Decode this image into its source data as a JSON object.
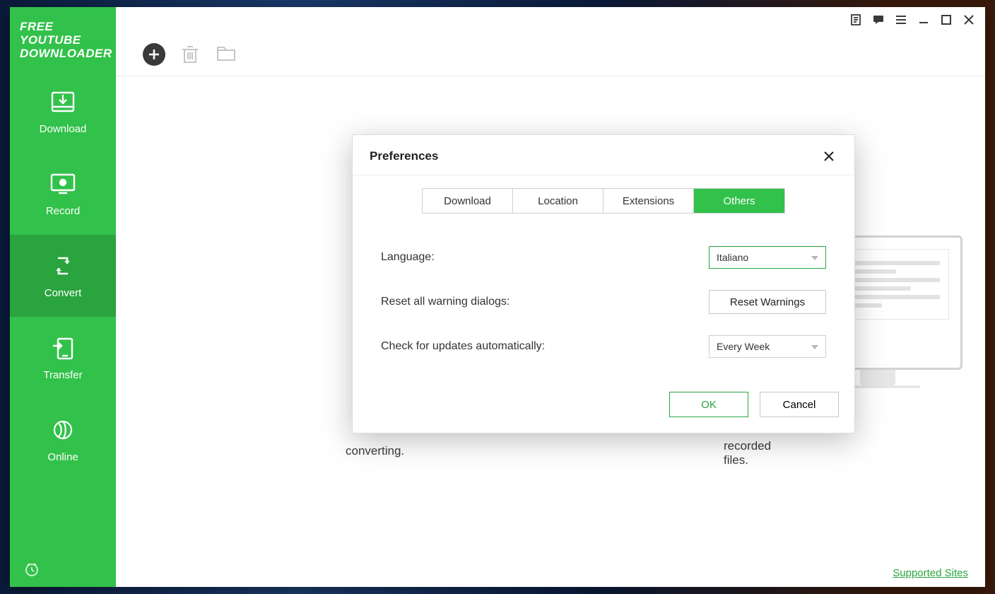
{
  "app": {
    "title_line1": "FREE YOUTUBE",
    "title_line2": "DOWNLOADER"
  },
  "sidebar": {
    "items": [
      {
        "label": "Download"
      },
      {
        "label": "Record"
      },
      {
        "label": "Convert"
      },
      {
        "label": "Transfer"
      },
      {
        "label": "Online"
      }
    ]
  },
  "background": {
    "partial_text": "converting.",
    "hint_text": "recorded files."
  },
  "footer": {
    "supported_sites": "Supported Sites"
  },
  "dialog": {
    "title": "Preferences",
    "tabs": [
      {
        "label": "Download"
      },
      {
        "label": "Location"
      },
      {
        "label": "Extensions"
      },
      {
        "label": "Others"
      }
    ],
    "rows": {
      "language_label": "Language:",
      "language_value": "Italiano",
      "reset_label": "Reset all warning dialogs:",
      "reset_button": "Reset Warnings",
      "updates_label": "Check for updates automatically:",
      "updates_value": "Every Week"
    },
    "buttons": {
      "ok": "OK",
      "cancel": "Cancel"
    }
  }
}
